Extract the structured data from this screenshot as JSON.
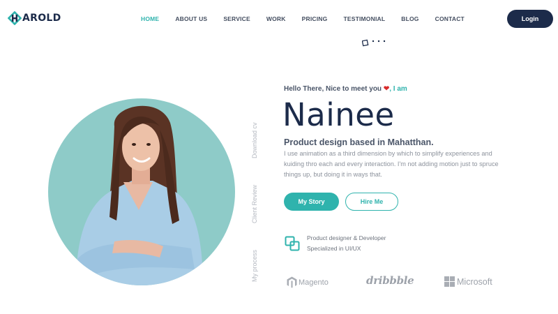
{
  "nav": {
    "logo_text": "AROLD",
    "items": [
      {
        "label": "HOME",
        "active": true
      },
      {
        "label": "ABOUT US"
      },
      {
        "label": "SERVICE"
      },
      {
        "label": "WORK"
      },
      {
        "label": "PRICING"
      },
      {
        "label": "TESTIMONIAL"
      },
      {
        "label": "BLOG"
      },
      {
        "label": "CONTACT"
      }
    ],
    "login_label": "Login"
  },
  "side_links": {
    "download_cv": "Download cv",
    "client_review": "Client Review",
    "my_process": "My process"
  },
  "hero": {
    "greeting": "Hello There, Nice to meet you",
    "greeting_suffix": ", I am",
    "name": "Nainee",
    "tagline": "Product design based in Mahatthan.",
    "description": "I use animation as a third dimension by which to simplify experiences and kuiding thro each and every interaction. I'm not adding motion just to spruce things up, but doing it in ways that.",
    "primary_button": "My Story",
    "secondary_button": "Hire Me",
    "role_line1": "Product designer & Developer",
    "role_line2": "Specialized in UI/UX"
  },
  "brands": {
    "magento": "Magento",
    "dribbble": "dribbble",
    "microsoft": "Microsoft"
  },
  "colors": {
    "accent": "#2fb3ad",
    "navy": "#1c2b4a",
    "portrait_bg": "#8ecbc8",
    "heart": "#d82b2b"
  }
}
